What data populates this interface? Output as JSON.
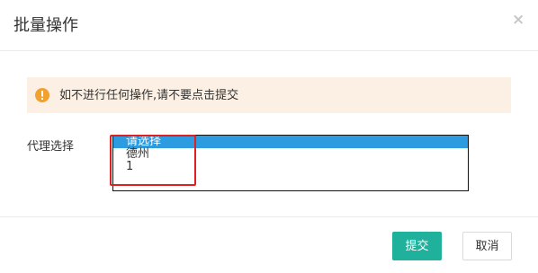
{
  "dialog": {
    "title": "批量操作",
    "close_glyph": "×"
  },
  "alert": {
    "icon": "info-icon",
    "text": "如不进行任何操作,请不要点击提交",
    "background_color": "#fcf0e4",
    "icon_color": "#f0a12f"
  },
  "form": {
    "agent_label": "代理选择",
    "agent_options": [
      {
        "label": "请选择",
        "selected": true
      },
      {
        "label": "德州",
        "selected": false
      },
      {
        "label": "1",
        "selected": false
      }
    ],
    "selected_color": "#2d9be0",
    "highlight_color": "#e02020"
  },
  "footer": {
    "submit_label": "提交",
    "cancel_label": "取消",
    "submit_color": "#1fb19b"
  }
}
